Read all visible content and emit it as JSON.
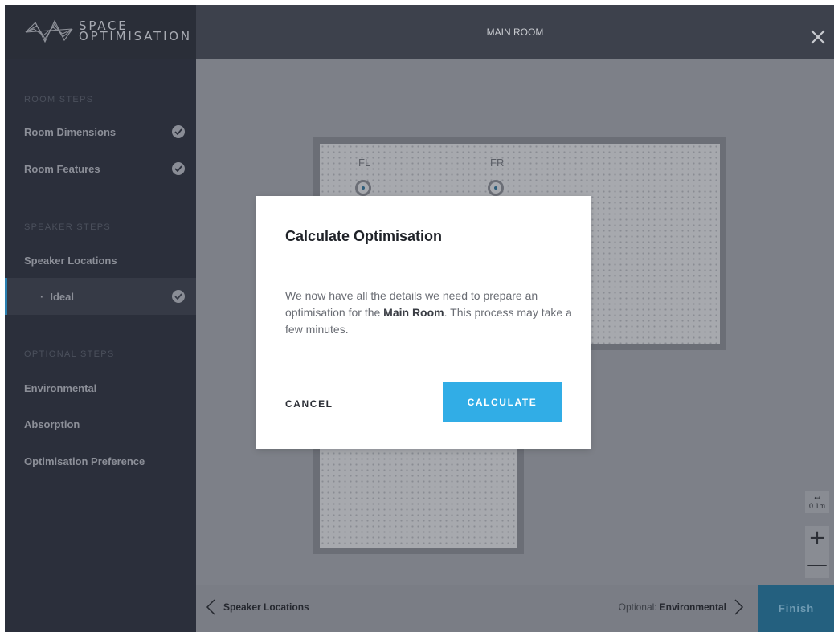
{
  "brand": {
    "line1": "SPACE",
    "line2": "OPTIMISATION",
    "logo_icon": "wave-logo-icon"
  },
  "header": {
    "title": "MAIN ROOM",
    "close_icon": "close-icon"
  },
  "sidebar": {
    "sections": [
      {
        "label": "ROOM STEPS",
        "items": [
          {
            "label": "Room Dimensions",
            "completed": true
          },
          {
            "label": "Room Features",
            "completed": true
          }
        ]
      },
      {
        "label": "SPEAKER STEPS",
        "items": [
          {
            "label": "Speaker Locations",
            "completed": false
          },
          {
            "label": "Ideal",
            "completed": true,
            "sub_item": true,
            "active": true
          }
        ]
      },
      {
        "label": "OPTIONAL STEPS",
        "items": [
          {
            "label": "Environmental",
            "completed": false
          },
          {
            "label": "Absorption",
            "completed": false
          },
          {
            "label": "Optimisation Preference",
            "completed": false
          }
        ]
      }
    ],
    "sub_bullet": "·"
  },
  "canvas": {
    "speakers": [
      {
        "label": "FL"
      },
      {
        "label": "FR"
      }
    ],
    "scale_label": "0.1m",
    "scale_icon": "↤",
    "zoom_in_label": "+",
    "zoom_out_label": "—"
  },
  "footer": {
    "back_label": "Speaker Locations",
    "next_prefix": "Optional:",
    "next_label": "Environmental",
    "finish_label": "Finish"
  },
  "modal": {
    "title": "Calculate Optimisation",
    "body_part1": "We now have all the details we need to prepare an optimisation for the ",
    "body_room": "Main Room",
    "body_part2": ". This process may take a few minutes.",
    "cancel_label": "CANCEL",
    "calculate_label": "CALCULATE"
  },
  "colors": {
    "accent": "#31ade6",
    "sidebar_bg": "#2b2f3b",
    "topbar_bg": "#3d414c",
    "finish_bg": "#24607f"
  }
}
